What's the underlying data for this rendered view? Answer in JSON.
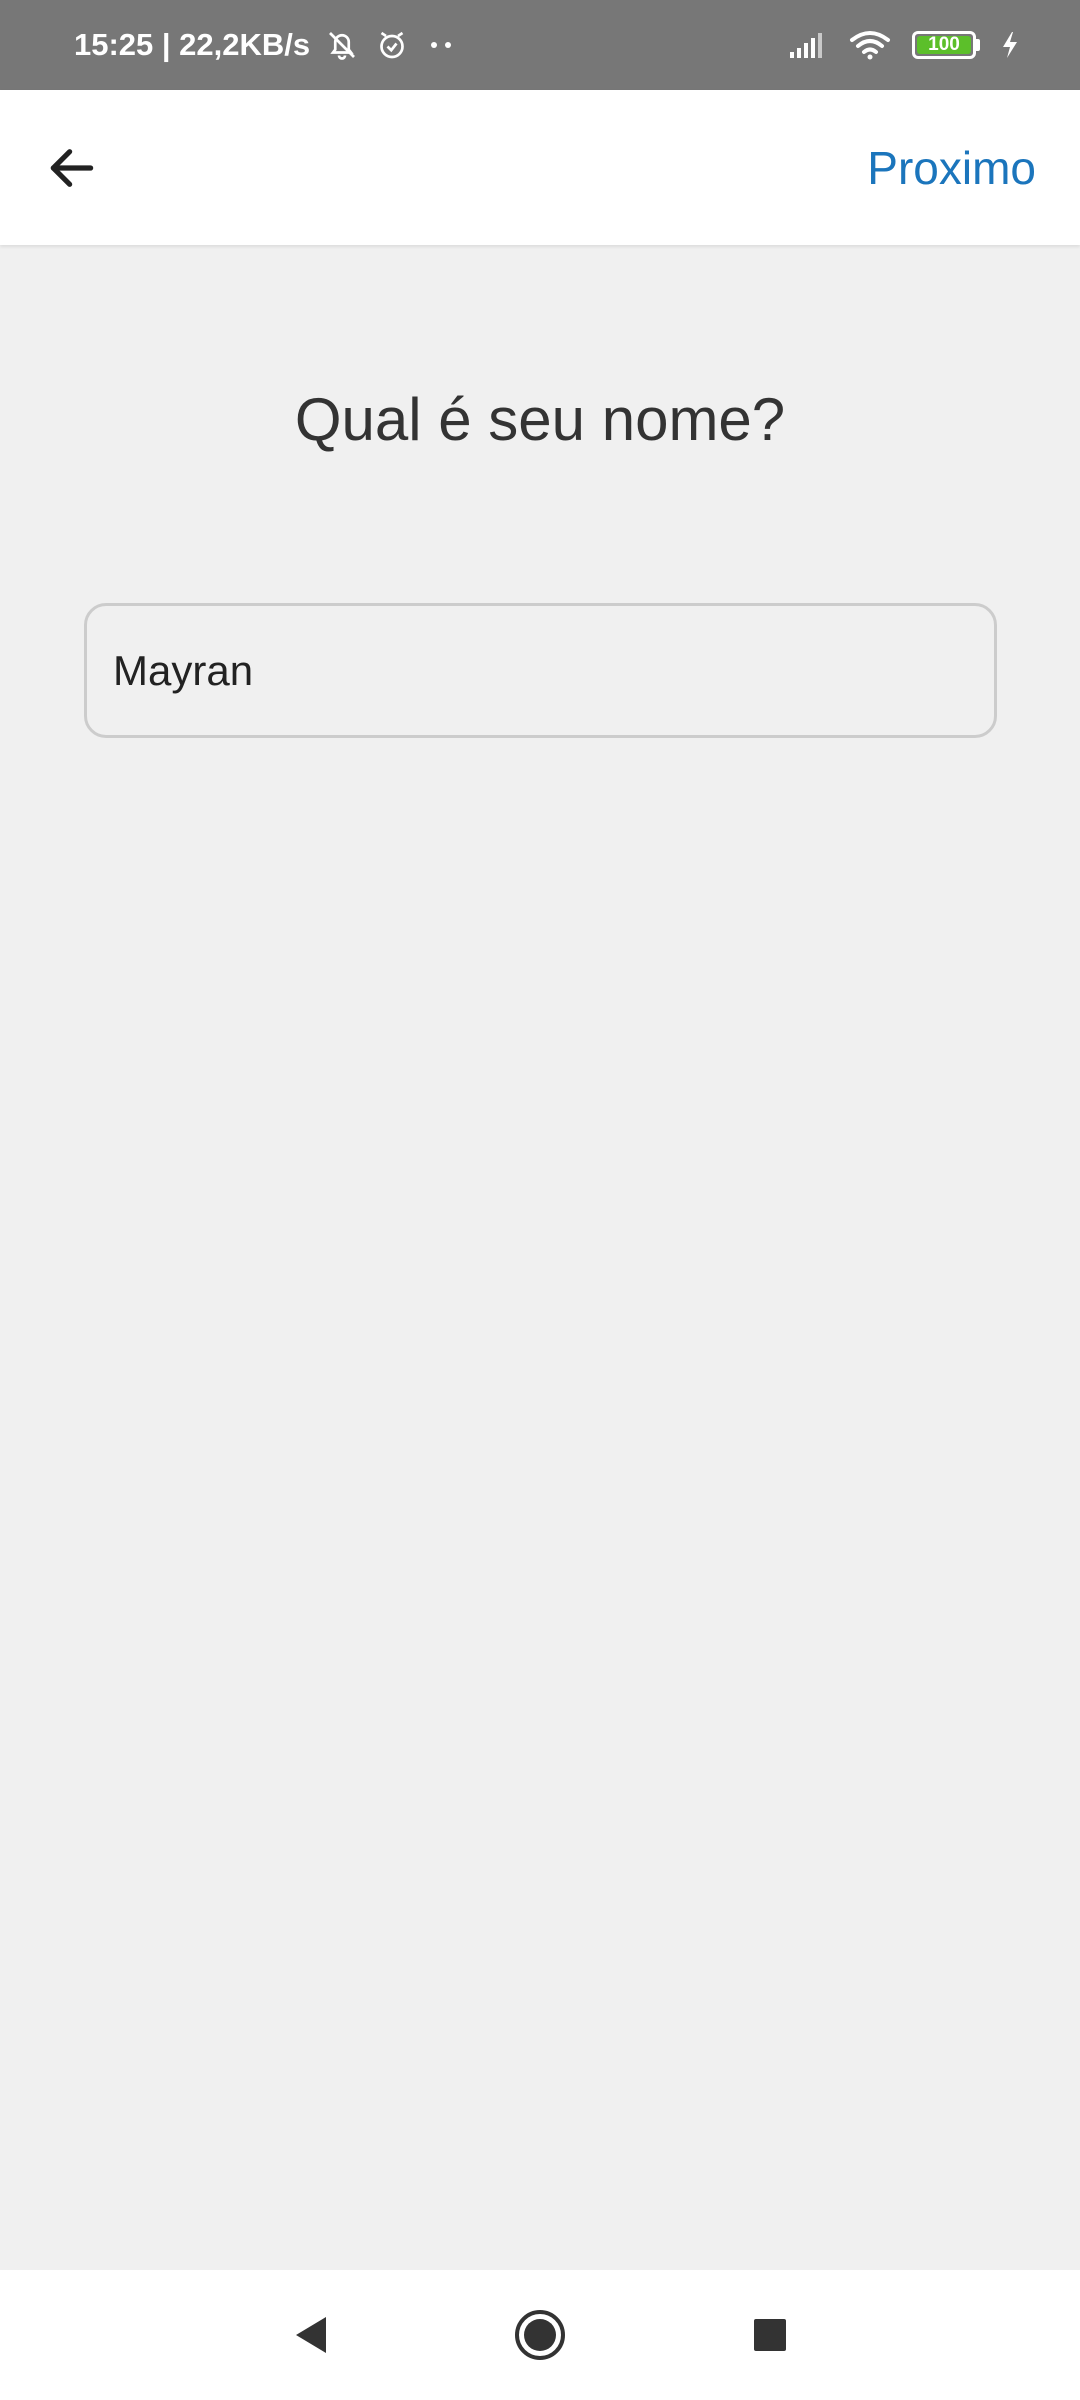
{
  "status_bar": {
    "time_speed": "15:25 | 22,2KB/s",
    "battery_level": "100",
    "icons": [
      "mute-bell-icon",
      "alarm-icon",
      "more-dots-icon",
      "signal-icon",
      "wifi-icon",
      "battery-icon",
      "charging-icon"
    ]
  },
  "app_bar": {
    "back_icon": "arrow-left-icon",
    "next_label": "Proximo",
    "accent_color": "#1b75bc"
  },
  "main": {
    "question": "Qual é seu nome?",
    "name_value": "Mayran"
  },
  "nav_bar": {
    "icons": [
      "back-triangle-icon",
      "home-circle-icon",
      "recents-square-icon"
    ]
  }
}
